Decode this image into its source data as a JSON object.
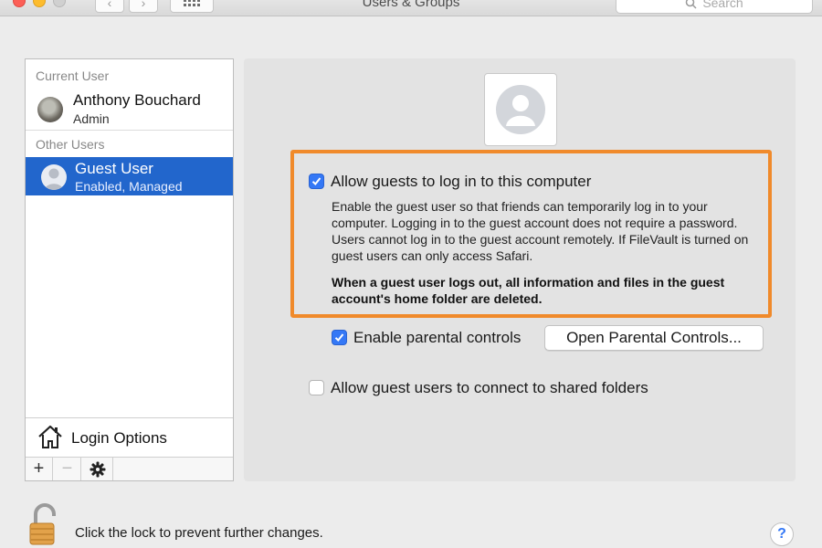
{
  "window": {
    "title": "Users & Groups",
    "search_placeholder": "Search",
    "back_symbol": "‹",
    "forward_symbol": "›"
  },
  "sidebar": {
    "current_user_label": "Current User",
    "current_user": {
      "name": "Anthony Bouchard",
      "role": "Admin",
      "avatar_icon": "user-photo"
    },
    "other_users_label": "Other Users",
    "other_users": [
      {
        "name": "Guest User",
        "status": "Enabled, Managed",
        "avatar_icon": "guest-avatar-icon",
        "selected": true
      }
    ],
    "login_options_label": "Login Options",
    "add_symbol": "+",
    "remove_symbol": "−",
    "action_symbol": "✱"
  },
  "detail": {
    "allow_guests": {
      "label": "Allow guests to log in to this computer",
      "checked": true
    },
    "description": "Enable the guest user so that friends can temporarily log in to your computer. Logging in to the guest account does not require a password. Users cannot log in to the guest account remotely. If FileVault is turned on guest users can only access Safari.",
    "warning": "When a guest user logs out, all information and files in the guest account's home folder are deleted.",
    "parental_controls": {
      "label": "Enable parental controls",
      "checked": true,
      "button_label": "Open Parental Controls..."
    },
    "shared_folders": {
      "label": "Allow guest users to connect to shared folders",
      "checked": false
    },
    "highlight_color": "#f08a2b"
  },
  "footer": {
    "lock_text": "Click the lock to prevent further changes.",
    "help_symbol": "?"
  },
  "colors": {
    "selection": "#2266cc",
    "checkbox": "#3478f6",
    "highlight": "#f08a2b"
  }
}
